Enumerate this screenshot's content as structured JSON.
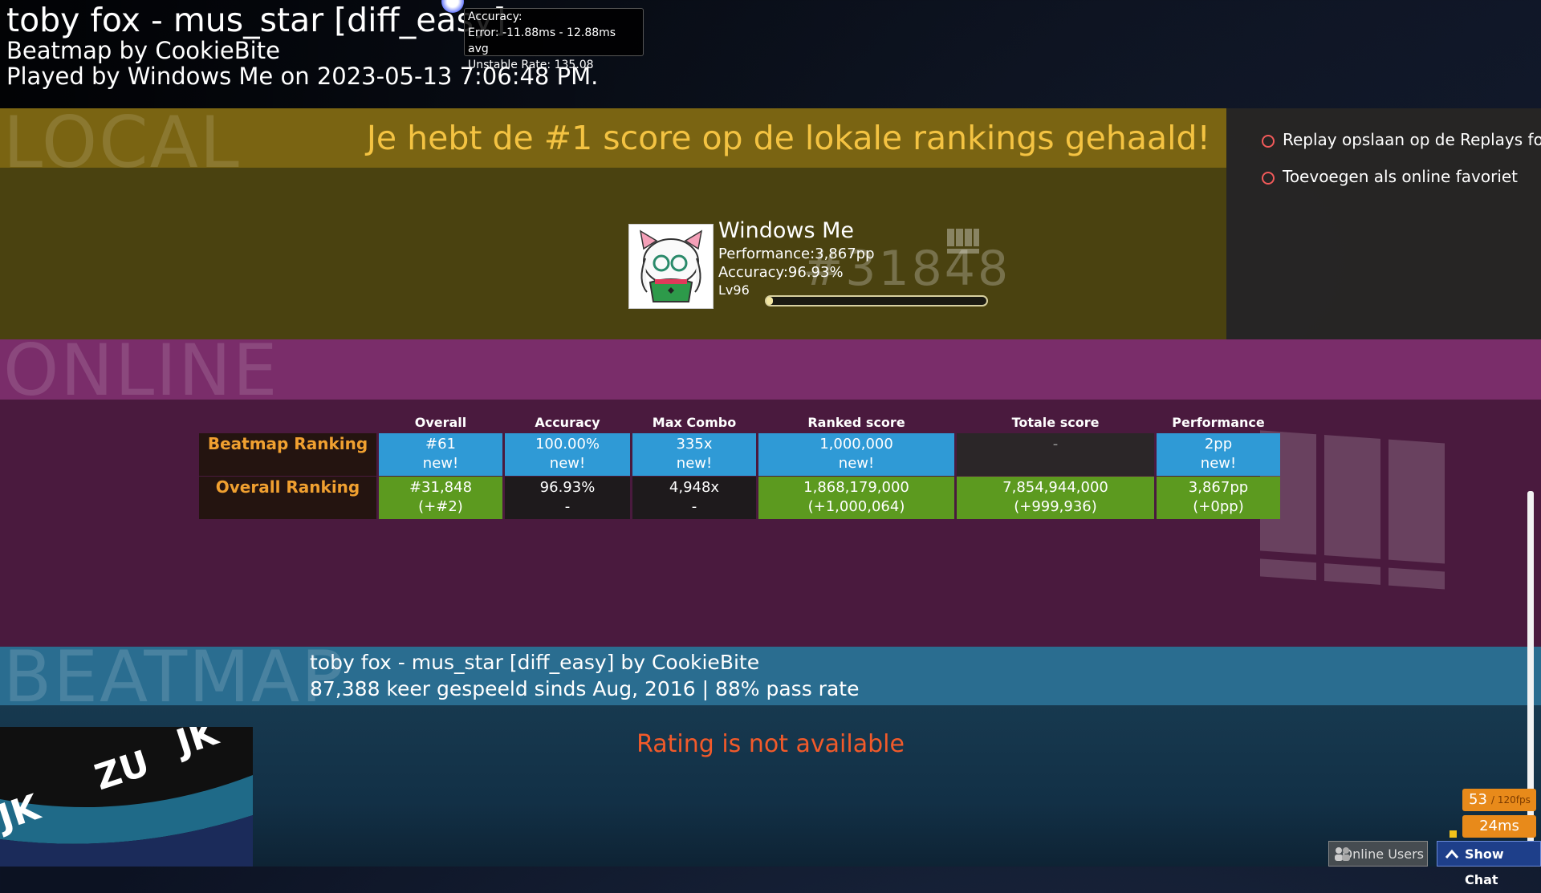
{
  "header": {
    "song_title": "toby fox - mus_star [diff_easy]",
    "mapper": "Beatmap by CookieBite",
    "played": "Played by Windows Me on 2023-05-13 7:06:48 PM."
  },
  "tooltip": {
    "line1": "Accuracy:",
    "line2": "Error: -11.88ms - 12.88ms avg",
    "line3": "Unstable Rate: 135.08"
  },
  "local": {
    "section_label": "LOCAL",
    "message": "Je hebt de #1 score op de lokale rankings gehaald!",
    "player_name": "Windows Me",
    "performance": "Performance:3,867pp",
    "accuracy": "Accuracy:96.93%",
    "level": "Lv96",
    "rank": "#31848",
    "level_progress": 0.03
  },
  "options": {
    "save_replay": "Replay opslaan op de Replays folde",
    "add_favourite": "Toevoegen als online favoriet"
  },
  "online": {
    "section_label": "ONLINE",
    "columns": [
      "Overall",
      "Accuracy",
      "Max Combo",
      "Ranked score",
      "Totale score",
      "Performance"
    ],
    "rows": [
      {
        "label": "Beatmap Ranking",
        "cells": [
          [
            "#61",
            "new!"
          ],
          [
            "100.00%",
            "new!"
          ],
          [
            "335x",
            "new!"
          ],
          [
            "1,000,000",
            "new!"
          ],
          [
            "-",
            ""
          ],
          [
            "2pp",
            "new!"
          ]
        ]
      },
      {
        "label": "Overall Ranking",
        "cells": [
          [
            "#31,848",
            "(+#2)"
          ],
          [
            "96.93%",
            "-"
          ],
          [
            "4,948x",
            "-"
          ],
          [
            "1,868,179,000",
            "(+1,000,064)"
          ],
          [
            "7,854,944,000",
            "(+999,936)"
          ],
          [
            "3,867pp",
            "(+0pp)"
          ]
        ]
      }
    ]
  },
  "beatmap": {
    "section_label": "BEATMAP",
    "title": "toby fox - mus_star [diff_easy] by CookieBite",
    "stats": "87,388 keer gespeeld sinds Aug, 2016 | 88% pass rate",
    "rating": "Rating is not available"
  },
  "overlay": {
    "fps": "53",
    "fps_target": "/ 120fps",
    "latency": "24ms",
    "online_users": "Online Users",
    "show_chat": "Show Chat"
  },
  "colors": {
    "local_header": "#7a6412",
    "local_body": "#4a4210",
    "online_header": "#7a2d6a",
    "online_body": "#4a1a3e",
    "beatmap_header": "#2a6d90",
    "accent_orange": "#e88a1a",
    "rating_red": "#f25a2a",
    "cell_blue": "#2f9ad6",
    "cell_green": "#5c9a1f"
  }
}
